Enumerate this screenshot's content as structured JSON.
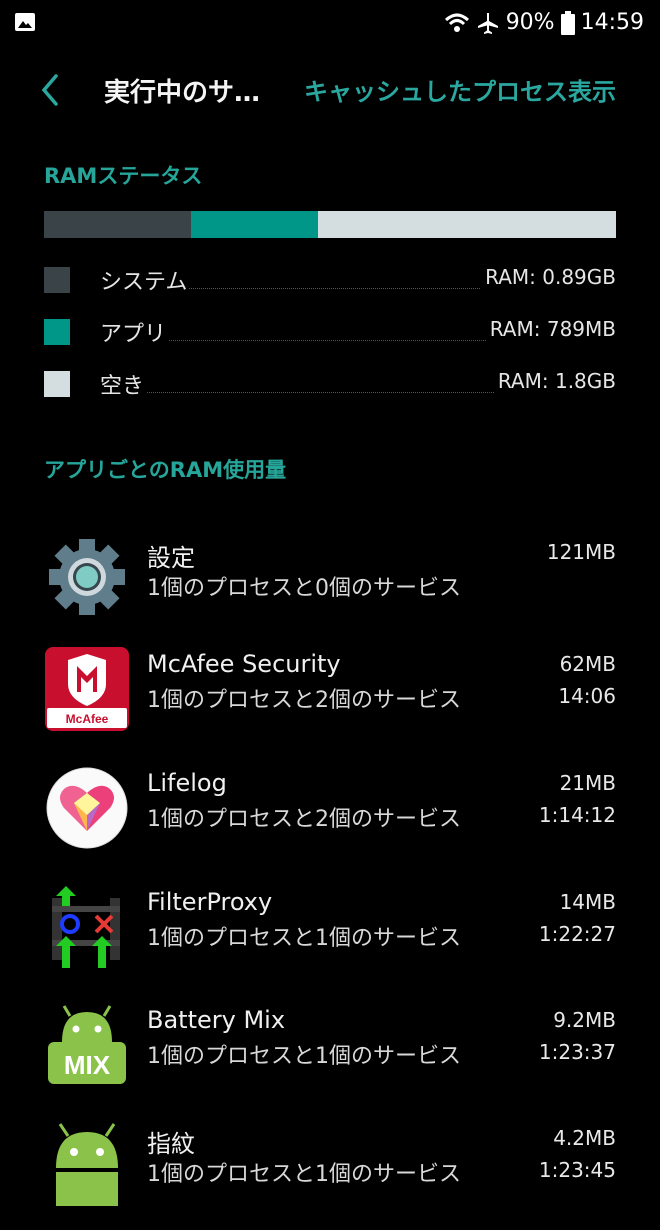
{
  "status_bar": {
    "battery_percent": "90%",
    "time": "14:59",
    "icons": [
      "image-icon",
      "wifi-icon",
      "airplane-icon",
      "battery-icon"
    ]
  },
  "app_bar": {
    "title": "実行中のサ…",
    "action": "キャッシュしたプロセス表示"
  },
  "ram_status": {
    "heading": "RAMステータス",
    "bar": [
      {
        "name": "system",
        "fraction": 0.257,
        "color": "#3a4348"
      },
      {
        "name": "app",
        "fraction": 0.222,
        "color": "#009688"
      },
      {
        "name": "free",
        "fraction": 0.521,
        "color": "#d4dde0"
      }
    ],
    "legend": [
      {
        "label": "システム",
        "value": "RAM: 0.89GB",
        "color": "#3a4348"
      },
      {
        "label": "アプリ",
        "value": "RAM: 789MB",
        "color": "#009688"
      },
      {
        "label": "空き",
        "value": "RAM: 1.8GB",
        "color": "#d4dde0"
      }
    ]
  },
  "per_app": {
    "heading": "アプリごとのRAM使用量",
    "apps": [
      {
        "name": "設定",
        "sub": "1個のプロセスと0個のサービス",
        "size": "121MB",
        "time": "",
        "icon": "settings-gear-icon"
      },
      {
        "name": "McAfee Security",
        "sub": "1個のプロセスと2個のサービス",
        "size": "62MB",
        "time": "14:06",
        "icon": "mcafee-icon",
        "icon_text": "McAfee"
      },
      {
        "name": "Lifelog",
        "sub": "1個のプロセスと2個のサービス",
        "size": "21MB",
        "time": "1:14:12",
        "icon": "lifelog-heart-icon"
      },
      {
        "name": "FilterProxy",
        "sub": "1個のプロセスと1個のサービス",
        "size": "14MB",
        "time": "1:22:27",
        "icon": "filterproxy-icon"
      },
      {
        "name": "Battery Mix",
        "sub": "1個のプロセスと1個のサービス",
        "size": "9.2MB",
        "time": "1:23:37",
        "icon": "battery-mix-icon",
        "icon_text": "MIX"
      },
      {
        "name": "指紋",
        "sub": "1個のプロセスと1個のサービス",
        "size": "4.2MB",
        "time": "1:23:45",
        "icon": "android-icon"
      }
    ]
  },
  "colors": {
    "accent": "#26a69a",
    "background": "#000000"
  }
}
